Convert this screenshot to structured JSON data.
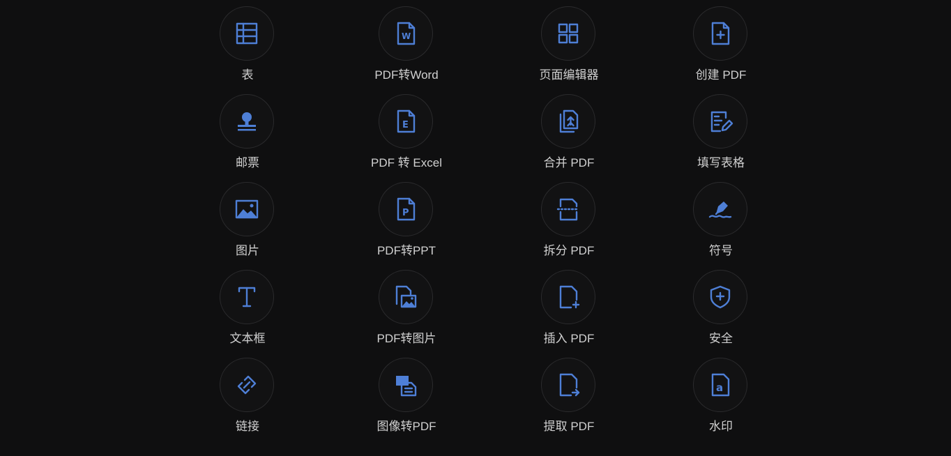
{
  "accent_color": "#4e7fd6",
  "tools": [
    {
      "label": "表",
      "icon": "table-icon"
    },
    {
      "label": "PDF转Word",
      "icon": "word-file-icon"
    },
    {
      "label": "页面编辑器",
      "icon": "grid-pages-icon"
    },
    {
      "label": "创建 PDF",
      "icon": "file-plus-icon"
    },
    {
      "label": "邮票",
      "icon": "stamp-icon"
    },
    {
      "label": "PDF 转 Excel",
      "icon": "excel-file-icon"
    },
    {
      "label": "合并 PDF",
      "icon": "merge-files-icon"
    },
    {
      "label": "填写表格",
      "icon": "fill-form-icon"
    },
    {
      "label": "图片",
      "icon": "image-icon"
    },
    {
      "label": "PDF转PPT",
      "icon": "ppt-file-icon"
    },
    {
      "label": "拆分 PDF",
      "icon": "split-file-icon"
    },
    {
      "label": "符号",
      "icon": "signature-pen-icon"
    },
    {
      "label": "文本框",
      "icon": "text-box-icon"
    },
    {
      "label": "PDF转图片",
      "icon": "file-to-image-icon"
    },
    {
      "label": "插入 PDF",
      "icon": "insert-file-icon"
    },
    {
      "label": "安全",
      "icon": "shield-plus-icon"
    },
    {
      "label": "链接",
      "icon": "link-icon"
    },
    {
      "label": "图像转PDF",
      "icon": "image-to-pdf-icon"
    },
    {
      "label": "提取 PDF",
      "icon": "extract-file-icon"
    },
    {
      "label": "水印",
      "icon": "watermark-icon"
    }
  ]
}
